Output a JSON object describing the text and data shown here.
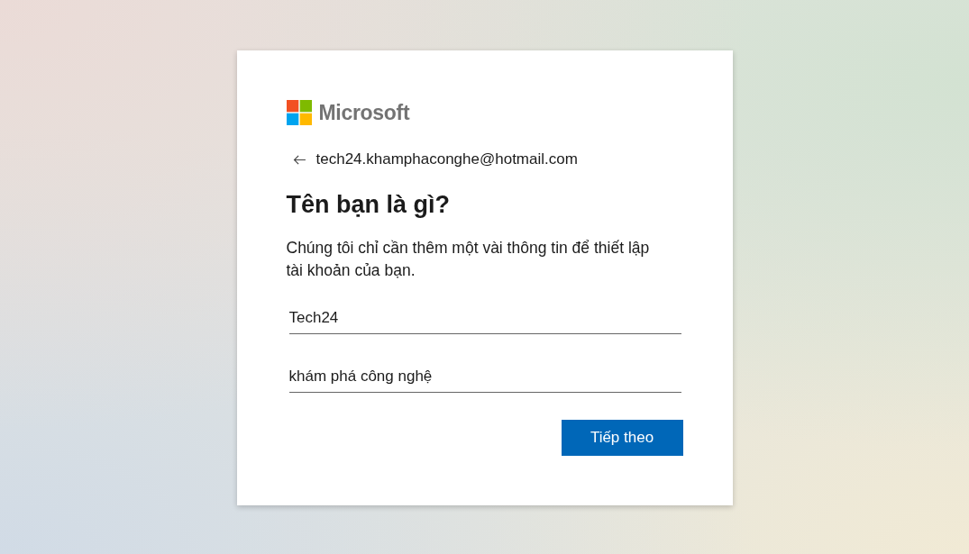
{
  "logo": {
    "wordmark": "Microsoft"
  },
  "identity": {
    "email": "tech24.khamphaconghe@hotmail.com"
  },
  "heading": "Tên bạn là gì?",
  "description": "Chúng tôi chỉ cần thêm một vài thông tin để thiết lập tài khoản của bạn.",
  "fields": [
    {
      "value": "Tech24"
    },
    {
      "value": "khám phá công nghệ"
    }
  ],
  "buttons": [
    {
      "label": "Tiếp theo",
      "kind": "primary"
    }
  ]
}
